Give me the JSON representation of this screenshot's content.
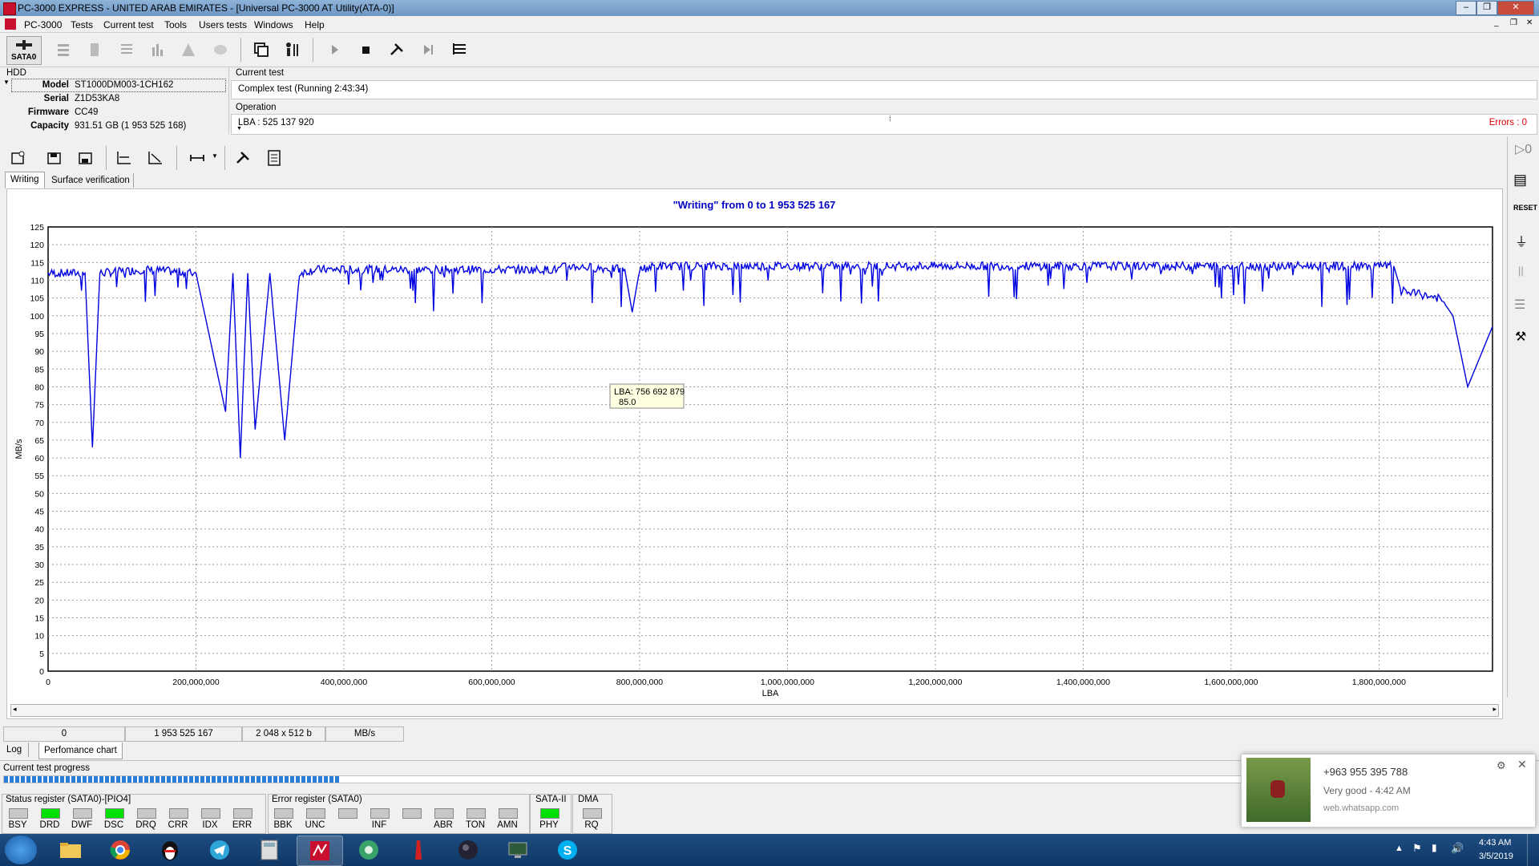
{
  "window": {
    "title": "PC-3000 EXPRESS - UNITED ARAB EMIRATES - [Universal PC-3000 AT Utility(ATA-0)]"
  },
  "menu": [
    "PC-3000",
    "Tests",
    "Current test",
    "Tools",
    "Users tests",
    "Windows",
    "Help"
  ],
  "toolbar": {
    "sata_label": "SATA0"
  },
  "hdd": {
    "group_label": "HDD",
    "rows": [
      {
        "label": "Model",
        "value": "ST1000DM003-1CH162"
      },
      {
        "label": "Serial",
        "value": "Z1D53KA8"
      },
      {
        "label": "Firmware",
        "value": "CC49"
      },
      {
        "label": "Capacity",
        "value": "931.51 GB (1 953 525 168)"
      }
    ]
  },
  "current_test": {
    "label": "Current test",
    "value": "Complex test (Running 2:43:34)",
    "operation_label": "Operation",
    "operation_value": "LBA : 525 137 920",
    "errors": "Errors : 0"
  },
  "tabs": {
    "top": [
      "Writing",
      "Surface verification"
    ],
    "bottom": [
      "Log",
      "Perfomance chart"
    ]
  },
  "chart_data": {
    "type": "line",
    "title": "\"Writing\" from 0 to 1 953 525 167",
    "xlabel": "LBA",
    "ylabel": "MB/s",
    "xlim": [
      0,
      1953525167
    ],
    "ylim": [
      0,
      125
    ],
    "grid": true,
    "x_ticks": [
      "0",
      "200,000,000",
      "400,000,000",
      "600,000,000",
      "800,000,000",
      "1,000,000,000",
      "1,200,000,000",
      "1,400,000,000",
      "1,600,000,000",
      "1,800,000,000"
    ],
    "y_ticks": [
      "0",
      "5",
      "10",
      "15",
      "20",
      "25",
      "30",
      "35",
      "40",
      "45",
      "50",
      "55",
      "60",
      "65",
      "70",
      "75",
      "80",
      "85",
      "90",
      "95",
      "100",
      "105",
      "110",
      "115",
      "120",
      "125"
    ],
    "series": [
      {
        "color": "#0000e0",
        "x": [
          0,
          50000000,
          60000000,
          70000000,
          130000000,
          200000000,
          240000000,
          250000000,
          260000000,
          270000000,
          280000000,
          300000000,
          320000000,
          340000000,
          360000000,
          400000000,
          500000000,
          600000000,
          690000000,
          700000000,
          780000000,
          790000000,
          800000000,
          820000000,
          900000000,
          1000000000,
          1100000000,
          1200000000,
          1300000000,
          1400000000,
          1500000000,
          1600000000,
          1700000000,
          1820000000,
          1830000000,
          1880000000,
          1890000000,
          1900000000,
          1920000000,
          1953525167
        ],
        "y": [
          112,
          112,
          63,
          112,
          113,
          112,
          73,
          112,
          60,
          112,
          68,
          112,
          65,
          112,
          113,
          113,
          113,
          113,
          113,
          114,
          113,
          101,
          113,
          114,
          114,
          114,
          114,
          114,
          114,
          114,
          114,
          114,
          114,
          114,
          107,
          105,
          103,
          100,
          80,
          97
        ]
      }
    ],
    "tooltip": {
      "line1": "LBA: 756 692 879",
      "line2": "85.0"
    }
  },
  "status_bar": [
    "0",
    "1 953 525 167",
    "2 048 x 512 b",
    "MB/s"
  ],
  "progress": {
    "label": "Current test progress",
    "fraction": 0.27
  },
  "registers": {
    "status_title": "Status register (SATA0)-[PIO4]",
    "status": [
      {
        "name": "BSY",
        "on": false
      },
      {
        "name": "DRD",
        "on": true
      },
      {
        "name": "DWF",
        "on": false
      },
      {
        "name": "DSC",
        "on": true
      },
      {
        "name": "DRQ",
        "on": false
      },
      {
        "name": "CRR",
        "on": false
      },
      {
        "name": "IDX",
        "on": false
      },
      {
        "name": "ERR",
        "on": false
      }
    ],
    "error_title": "Error register (SATA0)",
    "error": [
      {
        "name": "BBK",
        "on": false
      },
      {
        "name": "UNC",
        "on": false
      },
      {
        "name": "",
        "on": false
      },
      {
        "name": "INF",
        "on": false
      },
      {
        "name": "",
        "on": false
      },
      {
        "name": "ABR",
        "on": false
      },
      {
        "name": "TON",
        "on": false
      },
      {
        "name": "AMN",
        "on": false
      }
    ],
    "sata_title": "SATA-II",
    "sata": [
      {
        "name": "PHY",
        "on": true
      }
    ],
    "dma_title": "DMA",
    "dma": [
      {
        "name": "RQ",
        "on": false
      }
    ]
  },
  "notification": {
    "phone": "+963 955 395 788",
    "message": "Very good - 4:42 AM",
    "source": "web.whatsapp.com"
  },
  "clock": {
    "time": "4:43 AM",
    "date": "3/5/2019"
  },
  "colors": {
    "led_on": "#00e000",
    "led_off": "#c8c8c8",
    "chart_line": "#0000e0",
    "title_blue": "#0000c0",
    "errors_red": "#e00000"
  }
}
